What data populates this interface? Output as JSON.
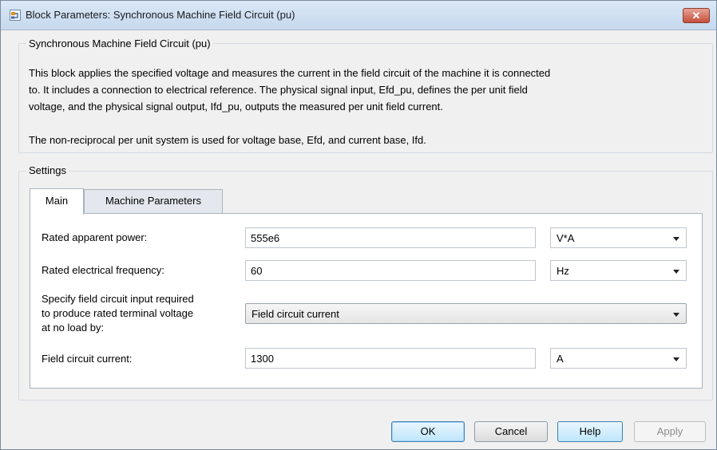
{
  "window": {
    "title": "Block Parameters: Synchronous Machine Field Circuit (pu)",
    "close_symbol": "✕"
  },
  "description": {
    "legend": "Synchronous Machine Field Circuit (pu)",
    "paragraph1_line1": "This block applies the specified voltage and measures the current in the field circuit of the machine it is connected",
    "paragraph1_line2": "to. It includes a connection to electrical reference. The physical signal input, Efd_pu, defines the per unit field",
    "paragraph1_line3": "voltage, and the physical signal output, Ifd_pu, outputs the measured per unit field current.",
    "paragraph2": "The non-reciprocal per unit system is used for voltage base, Efd, and current base, Ifd."
  },
  "settings": {
    "legend": "Settings",
    "tabs": [
      {
        "label": "Main",
        "active": true
      },
      {
        "label": "Machine Parameters",
        "active": false
      }
    ],
    "params": {
      "rated_power": {
        "label": "Rated apparent power:",
        "value": "555e6",
        "unit": "V*A"
      },
      "rated_freq": {
        "label": "Rated electrical frequency:",
        "value": "60",
        "unit": "Hz"
      },
      "field_spec": {
        "label_line1": "Specify field circuit input required",
        "label_line2": "to produce rated terminal voltage",
        "label_line3": "at no load by:",
        "value": "Field circuit current"
      },
      "field_current": {
        "label": "Field circuit current:",
        "value": "1300",
        "unit": "A"
      }
    }
  },
  "buttons": {
    "ok": "OK",
    "cancel": "Cancel",
    "help": "Help",
    "apply": "Apply"
  }
}
